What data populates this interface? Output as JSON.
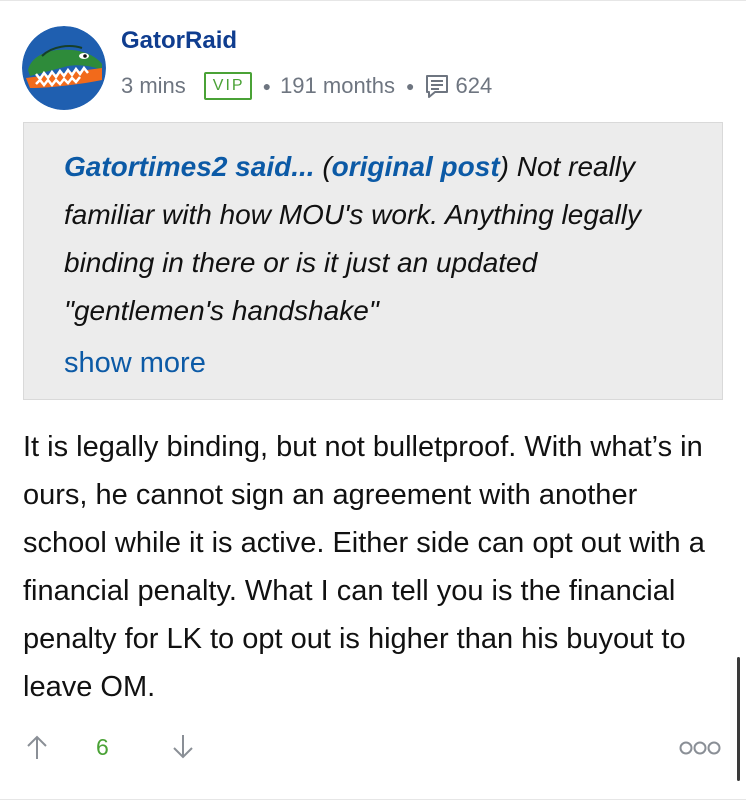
{
  "post": {
    "username": "GatorRaid",
    "time_ago": "3 mins",
    "badge": "VIP",
    "membership": "191 months",
    "comment_count": "624",
    "quote": {
      "author": "Gatortimes2 said...",
      "link_label": "original post",
      "text": " Not really familiar with how MOU's work. Anything legally binding in there or is it just an updated \"gentlemen's handshake\"",
      "show_more": "show more"
    },
    "body": "It is legally binding, but not bulletproof. With what’s in ours, he cannot sign an agreement with another school while it is active. Either side can opt out with a financial penalty. What I can tell you is the financial penalty for LK to opt out is higher than his buyout to leave OM.",
    "votes": "6"
  },
  "icons": {
    "avatar": "florida-gator-logo",
    "comments": "comments-icon",
    "upvote": "arrow-up-icon",
    "downvote": "arrow-down-icon",
    "more": "more-options-icon"
  },
  "colors": {
    "username": "#0f3d8f",
    "link": "#0c5aa6",
    "vip": "#4aa236",
    "quote_bg": "#ececec",
    "meta": "#6e7580"
  }
}
